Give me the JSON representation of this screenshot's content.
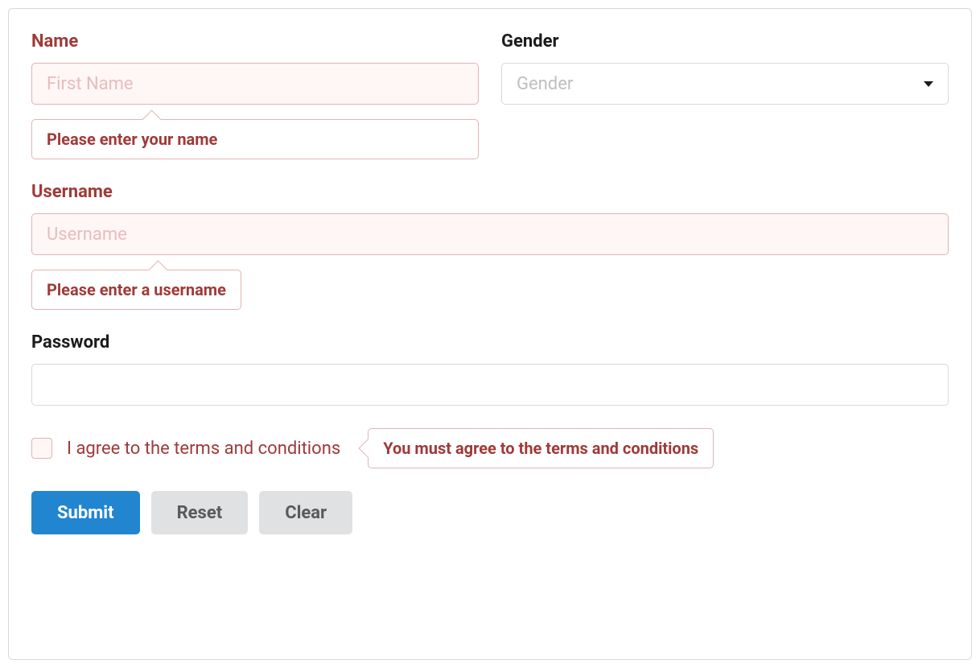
{
  "form": {
    "name": {
      "label": "Name",
      "placeholder": "First Name",
      "error": "Please enter your name"
    },
    "gender": {
      "label": "Gender",
      "placeholder": "Gender"
    },
    "username": {
      "label": "Username",
      "placeholder": "Username",
      "error": "Please enter a username"
    },
    "password": {
      "label": "Password"
    },
    "terms": {
      "label": "I agree to the terms and conditions",
      "error": "You must agree to the terms and conditions"
    },
    "buttons": {
      "submit": "Submit",
      "reset": "Reset",
      "clear": "Clear"
    }
  },
  "colors": {
    "error_text": "#9f3a38",
    "error_bg": "#fff6f6",
    "error_border": "#e0b4b4",
    "primary": "#2185d0",
    "secondary_bg": "#e0e1e2"
  }
}
